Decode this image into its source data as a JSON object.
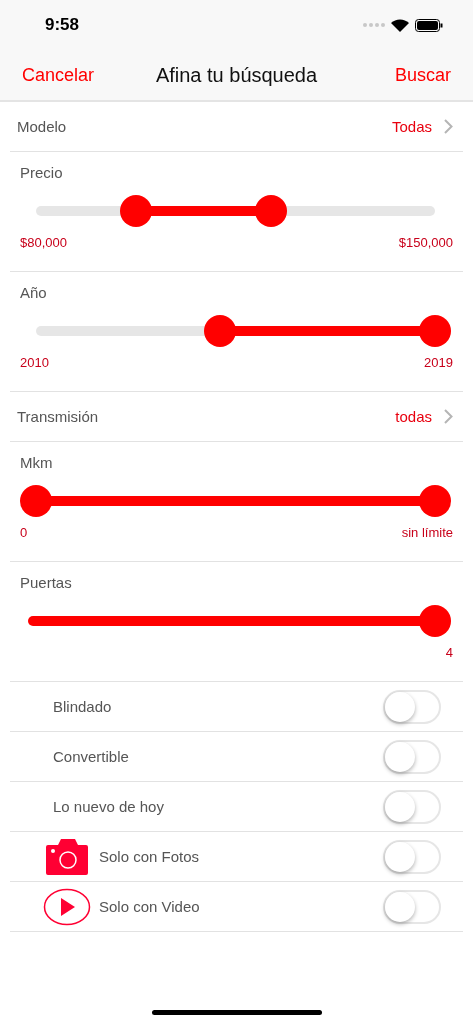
{
  "status_bar": {
    "time": "9:58"
  },
  "nav": {
    "cancel": "Cancelar",
    "title": "Afina tu búsqueda",
    "search": "Buscar"
  },
  "filters": [
    {
      "kind": "picker",
      "label": "Modelo",
      "value": "Todas"
    },
    {
      "kind": "range",
      "label": "Precio",
      "thumbs": [
        {
          "level": 0.25
        },
        {
          "level": 0.59
        }
      ],
      "min_text": "$80,000",
      "max_text": "$150,000"
    },
    {
      "kind": "range",
      "label": "Año",
      "thumbs": [
        {
          "level": 0.46
        },
        {
          "level": 1
        }
      ],
      "min_text": "2010",
      "max_text": "2019"
    },
    {
      "kind": "picker",
      "label": "Transmisión",
      "value": "todas"
    },
    {
      "kind": "range",
      "label": "Mkm",
      "thumbs": [
        {
          "level": 0
        },
        {
          "level": 1
        }
      ],
      "min_text": "0",
      "max_text": "sin límite"
    },
    {
      "kind": "slider",
      "label": "Puertas",
      "level": 1,
      "max_text": "4"
    }
  ],
  "toggles": [
    {
      "kind": "plain",
      "label": "Blindado",
      "on": false
    },
    {
      "kind": "plain",
      "label": "Convertible",
      "on": false
    },
    {
      "kind": "plain",
      "label": "Lo nuevo de hoy",
      "on": false
    },
    {
      "kind": "camera",
      "label": "Solo con Fotos",
      "on": false
    },
    {
      "kind": "video",
      "label": "Solo con Video",
      "on": false
    }
  ]
}
